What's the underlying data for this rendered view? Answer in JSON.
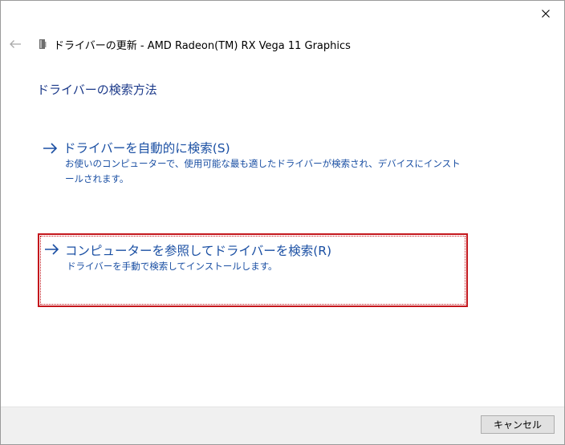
{
  "window": {
    "title": "ドライバーの更新 - AMD Radeon(TM) RX Vega 11 Graphics"
  },
  "page": {
    "heading": "ドライバーの検索方法"
  },
  "options": [
    {
      "title": "ドライバーを自動的に検索(S)",
      "description": "お使いのコンピューターで、使用可能な最も適したドライバーが検索され、デバイスにインストールされます。"
    },
    {
      "title": "コンピューターを参照してドライバーを検索(R)",
      "description": "ドライバーを手動で検索してインストールします。"
    }
  ],
  "footer": {
    "cancel_label": "キャンセル"
  },
  "icons": {
    "close": "close-icon",
    "back": "back-arrow-icon",
    "device": "device-icon",
    "option_arrow": "arrow-right-icon"
  },
  "colors": {
    "link": "#1a4fa3",
    "heading": "#1c3a8a",
    "focus_border": "#c4161c",
    "footer_bg": "#f0f0f0"
  }
}
